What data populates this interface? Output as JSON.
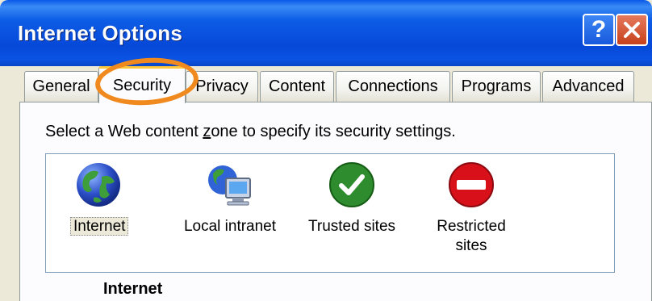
{
  "window": {
    "title": "Internet Options"
  },
  "titlebar": {
    "help_label": "?",
    "close_icon": "close-icon"
  },
  "tabs": [
    {
      "label": "General"
    },
    {
      "label": "Security",
      "active": true
    },
    {
      "label": "Privacy"
    },
    {
      "label": "Content"
    },
    {
      "label": "Connections"
    },
    {
      "label": "Programs"
    },
    {
      "label": "Advanced"
    }
  ],
  "security": {
    "prompt_prefix": "Select a Web content ",
    "prompt_underlined": "z",
    "prompt_suffix": "one to specify its security settings.",
    "zones": [
      {
        "label": "Internet",
        "icon": "globe-icon",
        "selected": true
      },
      {
        "label": "Local intranet",
        "icon": "intranet-icon"
      },
      {
        "label": "Trusted sites",
        "icon": "trusted-check-icon"
      },
      {
        "label_line1": "Restricted",
        "label_line2": "sites",
        "icon": "restricted-icon"
      }
    ],
    "selected_zone_title": "Internet"
  },
  "colors": {
    "titlebar_blue": "#0A58E8",
    "tab_active_highlight": "#FFC83C",
    "annotation_orange": "#F08A1E",
    "trusted_green": "#2E8B2E",
    "restricted_red": "#D8101A"
  }
}
